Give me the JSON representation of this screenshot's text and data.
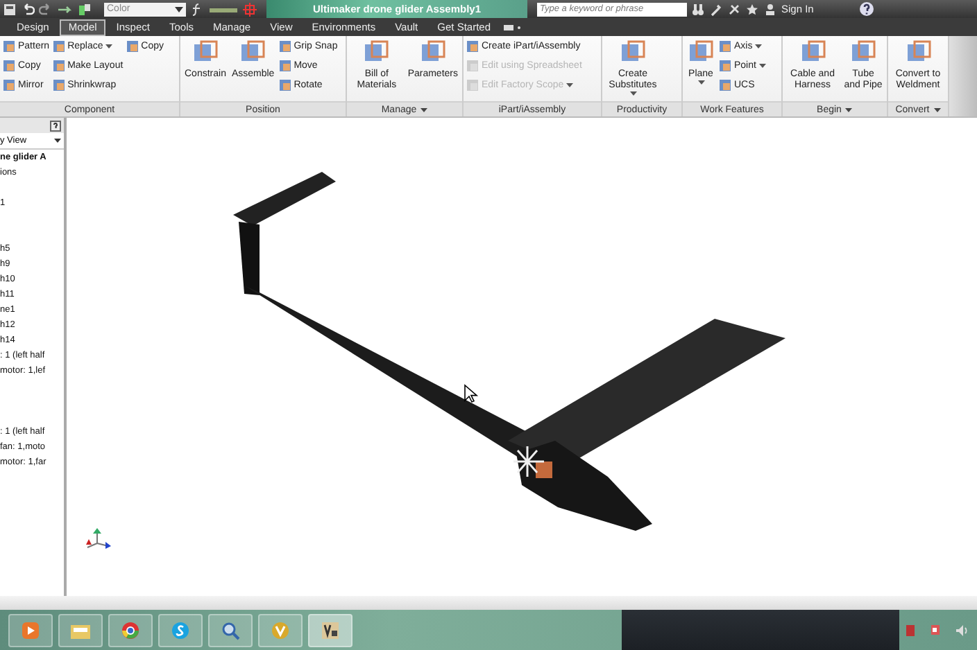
{
  "title_bar": {
    "color_field": "Color",
    "title": "Ultimaker drone glider Assembly1",
    "search": {
      "placeholder": "Type a keyword or phrase"
    },
    "sign_in": "Sign In"
  },
  "tabs": [
    {
      "label": "Design",
      "selected": false
    },
    {
      "label": "Model",
      "selected": true
    },
    {
      "label": "Inspect",
      "selected": false
    },
    {
      "label": "Tools",
      "selected": false
    },
    {
      "label": "Manage",
      "selected": false
    },
    {
      "label": "View",
      "selected": false
    },
    {
      "label": "Environments",
      "selected": false
    },
    {
      "label": "Vault",
      "selected": false
    },
    {
      "label": "Get Started",
      "selected": false
    }
  ],
  "ribbon": {
    "panels": [
      {
        "title": "Component",
        "menu": false,
        "groups": [
          {
            "kind": "stack",
            "items": [
              {
                "label": "Pattern",
                "disabled": false,
                "caret": false
              },
              {
                "label": "Copy",
                "disabled": false,
                "caret": false
              },
              {
                "label": "Mirror",
                "disabled": false,
                "caret": false
              }
            ]
          },
          {
            "kind": "stack",
            "items": [
              {
                "label": "Replace",
                "disabled": false,
                "caret": true
              },
              {
                "label": "Make Layout",
                "disabled": false,
                "caret": false
              },
              {
                "label": "Shrinkwrap",
                "disabled": false,
                "caret": false
              }
            ]
          },
          {
            "kind": "stack",
            "items": [
              {
                "label": "Copy",
                "disabled": false,
                "caret": false
              }
            ]
          }
        ]
      },
      {
        "title": "Position",
        "menu": false,
        "groups": [
          {
            "kind": "large",
            "label": "Constrain",
            "caret": false
          },
          {
            "kind": "large",
            "label": "Assemble",
            "caret": false
          },
          {
            "kind": "stack",
            "items": [
              {
                "label": "Grip Snap",
                "disabled": false,
                "caret": false
              },
              {
                "label": "Move",
                "disabled": false,
                "caret": false
              },
              {
                "label": "Rotate",
                "disabled": false,
                "caret": false
              }
            ]
          }
        ]
      },
      {
        "title": "Manage",
        "menu": true,
        "groups": [
          {
            "kind": "large",
            "label": "Bill of Materials",
            "caret": false
          },
          {
            "kind": "large",
            "label": "Parameters",
            "caret": false
          }
        ]
      },
      {
        "title": "iPart/iAssembly",
        "menu": false,
        "groups": [
          {
            "kind": "stack",
            "items": [
              {
                "label": "Create iPart/iAssembly",
                "disabled": false,
                "caret": false
              },
              {
                "label": "Edit using Spreadsheet",
                "disabled": true,
                "caret": false
              },
              {
                "label": "Edit Factory Scope",
                "disabled": true,
                "caret": true
              }
            ]
          }
        ]
      },
      {
        "title": "Productivity",
        "menu": false,
        "groups": [
          {
            "kind": "large",
            "label": "Create Substitutes",
            "caret": true
          }
        ]
      },
      {
        "title": "Work Features",
        "menu": false,
        "groups": [
          {
            "kind": "large",
            "label": "Plane",
            "caret": true
          },
          {
            "kind": "stack",
            "items": [
              {
                "label": "Axis",
                "disabled": false,
                "caret": true
              },
              {
                "label": "Point",
                "disabled": false,
                "caret": true
              },
              {
                "label": "UCS",
                "disabled": false,
                "caret": false
              }
            ]
          }
        ]
      },
      {
        "title": "Begin",
        "menu": true,
        "groups": [
          {
            "kind": "large",
            "label": "Cable and Harness",
            "caret": false
          },
          {
            "kind": "large",
            "label": "Tube and Pipe",
            "caret": false
          }
        ]
      },
      {
        "title": "Convert",
        "menu": true,
        "groups": [
          {
            "kind": "large",
            "label": "Convert to Weldment",
            "caret": false
          }
        ]
      }
    ]
  },
  "browser": {
    "view": "y View",
    "root": "ne glider A",
    "groups": [
      [
        "ions"
      ],
      [
        "1"
      ],
      [
        "h5",
        "h9",
        "h10",
        "h11",
        "ne1",
        "h12",
        "h14",
        ": 1 (left half",
        "motor: 1,lef"
      ],
      [
        ": 1 (left half",
        "fan: 1,moto",
        "motor: 1,far"
      ]
    ]
  }
}
